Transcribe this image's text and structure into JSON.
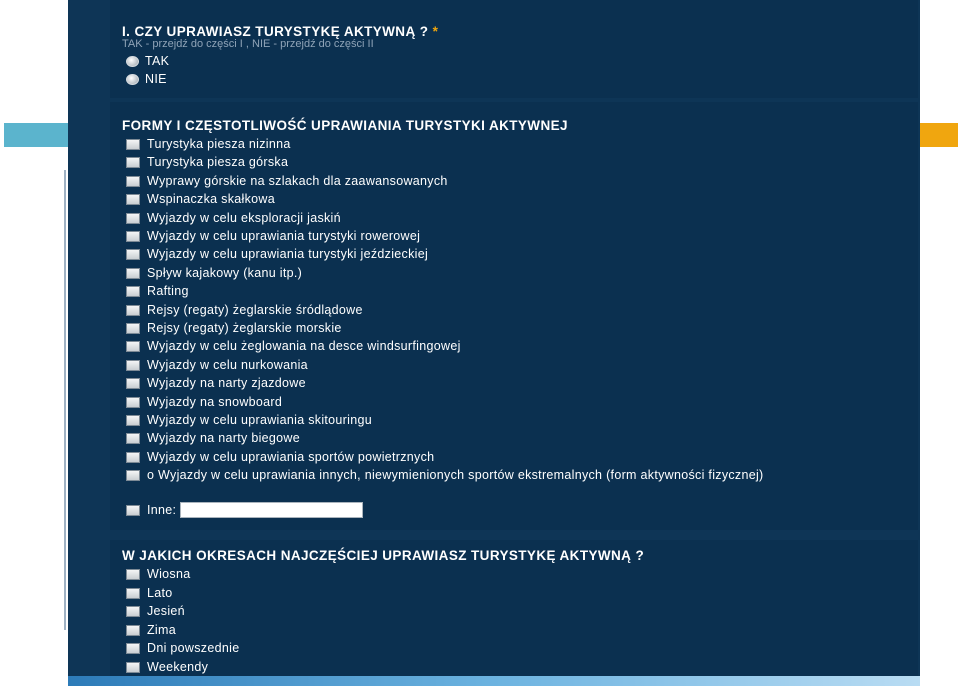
{
  "section1": {
    "title": "I. CZY UPRAWIASZ TURYSTYKĘ AKTYWNĄ ?",
    "required_marker": "*",
    "hint": "TAK - przejdź do części I , NIE - przejdź do części II",
    "options": [
      "TAK",
      "NIE"
    ]
  },
  "section2": {
    "title": "FORMY I CZĘSTOTLIWOŚĆ UPRAWIANIA TURYSTYKI AKTYWNEJ",
    "options": [
      "Turystyka piesza nizinna",
      "Turystyka piesza górska",
      "Wyprawy górskie na szlakach dla zaawansowanych",
      "Wspinaczka skałkowa",
      "Wyjazdy w celu eksploracji jaskiń",
      "Wyjazdy w celu uprawiania turystyki rowerowej",
      "Wyjazdy w celu uprawiania turystyki jeździeckiej",
      "Spływ kajakowy (kanu itp.)",
      "Rafting",
      "Rejsy (regaty) żeglarskie śródlądowe",
      "Rejsy (regaty) żeglarskie morskie",
      "Wyjazdy w celu żeglowania na desce windsurfingowej",
      "Wyjazdy w celu nurkowania",
      "Wyjazdy na narty zjazdowe",
      "Wyjazdy na snowboard",
      "Wyjazdy w celu uprawiania skitouringu",
      "Wyjazdy na narty biegowe",
      "Wyjazdy w celu uprawiania sportów powietrznych",
      "o Wyjazdy w celu uprawiania innych, niewymienionych sportów ekstremalnych (form aktywności fizycznej)"
    ],
    "other_label": "Inne:",
    "other_value": ""
  },
  "section3": {
    "title": "W JAKICH OKRESACH NAJCZĘŚCIEJ UPRAWIASZ TURYSTYKĘ AKTYWNĄ ?",
    "options": [
      "Wiosna",
      "Lato",
      "Jesień",
      "Zima",
      "Dni powszednie",
      "Weekendy"
    ]
  },
  "colors": {
    "panel": "#0e3556",
    "section": "#0b3050",
    "hint": "#8fa3b7",
    "required": "#f0a60f",
    "accent_left": "#5bb4cd",
    "accent_right": "#f0a60f"
  }
}
